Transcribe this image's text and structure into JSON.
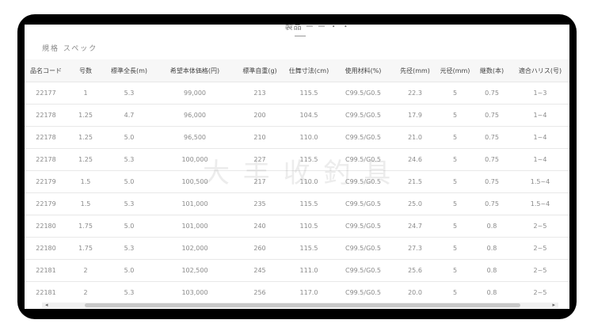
{
  "header": {
    "title": "製品 ー ー ・ ・"
  },
  "spec": {
    "caption": "規格 スペック",
    "columns": [
      "品名コード",
      "号数",
      "標準全長(m)",
      "希望本体価格(円)",
      "標準自重(g)",
      "仕舞寸法(cm)",
      "使用材料(%)",
      "先径(mm)",
      "元径(mm)",
      "継数(本)",
      "適合ハリス(号)"
    ],
    "rows": [
      [
        "22177",
        "1",
        "5.3",
        "99,000",
        "213",
        "115.5",
        "C99.5/G0.5",
        "22.3",
        "5",
        "0.75",
        "1~3"
      ],
      [
        "22178",
        "1.25",
        "4.7",
        "96,000",
        "200",
        "104.5",
        "C99.5/G0.5",
        "17.9",
        "5",
        "0.75",
        "1~4"
      ],
      [
        "22178",
        "1.25",
        "5.0",
        "96,500",
        "210",
        "110.0",
        "C99.5/G0.5",
        "21.0",
        "5",
        "0.75",
        "1~4"
      ],
      [
        "22178",
        "1.25",
        "5.3",
        "100,000",
        "227",
        "115.5",
        "C99.5/G0.5",
        "24.6",
        "5",
        "0.75",
        "1~4"
      ],
      [
        "22179",
        "1.5",
        "5.0",
        "100,500",
        "217",
        "110.0",
        "C99.5/G0.5",
        "21.5",
        "5",
        "0.75",
        "1.5~4"
      ],
      [
        "22179",
        "1.5",
        "5.3",
        "101,000",
        "235",
        "115.5",
        "C99.5/G0.5",
        "25.0",
        "5",
        "0.75",
        "1.5~4"
      ],
      [
        "22180",
        "1.75",
        "5.0",
        "101,000",
        "240",
        "110.5",
        "C99.5/G0.5",
        "24.7",
        "5",
        "0.8",
        "2~5"
      ],
      [
        "22180",
        "1.75",
        "5.3",
        "102,000",
        "260",
        "115.5",
        "C99.5/G0.5",
        "27.3",
        "5",
        "0.8",
        "2~5"
      ],
      [
        "22181",
        "2",
        "5.0",
        "102,500",
        "245",
        "111.0",
        "C99.5/G0.5",
        "25.6",
        "5",
        "0.8",
        "2~5"
      ],
      [
        "22181",
        "2",
        "5.3",
        "103,000",
        "256",
        "117.0",
        "C99.5/G0.5",
        "20.0",
        "5",
        "0.8",
        "2~5"
      ]
    ]
  },
  "watermark": "大 丰 收 釣 具",
  "scroll": {
    "left_arrow": "◂",
    "right_arrow": "▸"
  }
}
